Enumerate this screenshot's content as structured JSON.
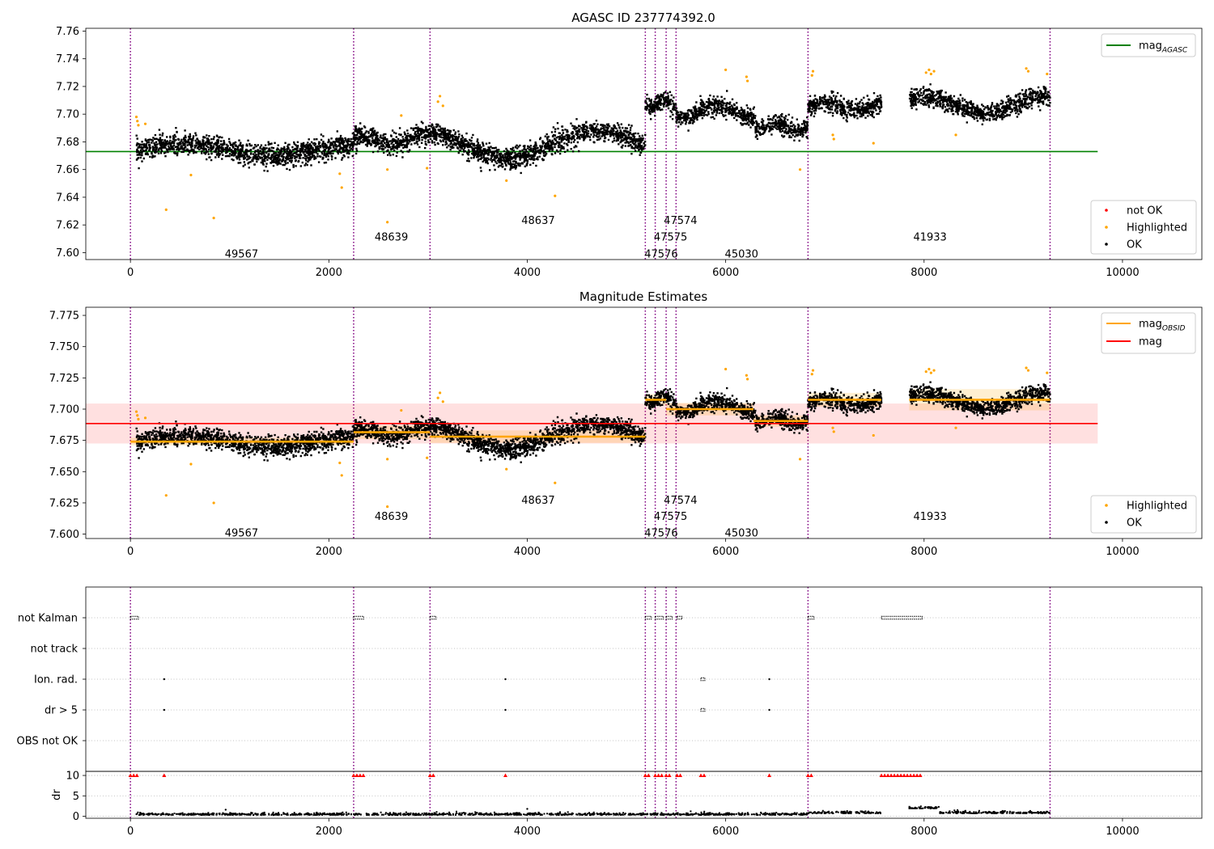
{
  "colors": {
    "ok": "#000000",
    "highlighted": "#ffa500",
    "not_ok": "#ff0000",
    "mag_agasc": "#008000",
    "mag_obsid": "#ffa500",
    "mag": "#ff0000",
    "obs_boundary": "#800080",
    "grid": "#b0b0b0"
  },
  "chart_data": [
    {
      "type": "scatter",
      "title": "AGASC ID 237774392.0",
      "xlim": [
        -450,
        10800
      ],
      "ylim": [
        7.595,
        7.762
      ],
      "xticks": [
        0,
        2000,
        4000,
        6000,
        8000,
        10000
      ],
      "yticks": [
        7.6,
        7.62,
        7.64,
        7.66,
        7.68,
        7.7,
        7.72,
        7.74,
        7.76
      ],
      "ytick_labels": [
        "7.60",
        "7.62",
        "7.64",
        "7.66",
        "7.68",
        "7.70",
        "7.72",
        "7.74",
        "7.76"
      ],
      "lines": [
        {
          "name": "mag",
          "sub": "AGASC",
          "y": 7.673,
          "x": [
            -450,
            9750
          ]
        }
      ],
      "legend_upper": [
        {
          "label": "mag",
          "sub": "AGASC",
          "color": "#008000"
        }
      ],
      "legend_lower": [
        {
          "label": "not OK",
          "color": "#ff0000"
        },
        {
          "label": "Highlighted",
          "color": "#ffa500"
        },
        {
          "label": "OK",
          "color": "#000000"
        }
      ],
      "obsid_labels": [
        {
          "text": "49567",
          "x": 1120,
          "y": 7.5995
        },
        {
          "text": "48639",
          "x": 2630,
          "y": 7.6115
        },
        {
          "text": "48637",
          "x": 4110,
          "y": 7.6235
        },
        {
          "text": "47574",
          "x": 5545,
          "y": 7.6235
        },
        {
          "text": "47575",
          "x": 5445,
          "y": 7.6115
        },
        {
          "text": "47576",
          "x": 5350,
          "y": 7.5995
        },
        {
          "text": "45030",
          "x": 6160,
          "y": 7.5995
        },
        {
          "text": "41933",
          "x": 8060,
          "y": 7.6115
        }
      ]
    },
    {
      "type": "scatter",
      "title": "Magnitude Estimates",
      "xlim": [
        -450,
        10800
      ],
      "ylim": [
        7.5965,
        7.7815
      ],
      "xticks": [
        0,
        2000,
        4000,
        6000,
        8000,
        10000
      ],
      "yticks": [
        7.6,
        7.625,
        7.65,
        7.675,
        7.7,
        7.725,
        7.75,
        7.775
      ],
      "ytick_labels": [
        "7.600",
        "7.625",
        "7.650",
        "7.675",
        "7.700",
        "7.725",
        "7.750",
        "7.775"
      ],
      "mag_band": {
        "center": 7.6885,
        "low": 7.6725,
        "high": 7.7045,
        "x": [
          -450,
          9750
        ]
      },
      "obsid_mags": [
        {
          "x0": 0,
          "x1": 2250,
          "y": 7.674,
          "low": 7.671,
          "high": 7.677
        },
        {
          "x0": 2250,
          "x1": 3020,
          "y": 7.6815,
          "low": 7.676,
          "high": 7.687
        },
        {
          "x0": 3020,
          "x1": 5190,
          "y": 7.678,
          "low": 7.673,
          "high": 7.683
        },
        {
          "x0": 5190,
          "x1": 5400,
          "y": 7.7075,
          "low": 7.703,
          "high": 7.712
        },
        {
          "x0": 5400,
          "x1": 6280,
          "y": 7.7,
          "low": 7.695,
          "high": 7.705
        },
        {
          "x0": 6280,
          "x1": 6830,
          "y": 7.6905,
          "low": 7.686,
          "high": 7.695
        },
        {
          "x0": 6830,
          "x1": 7570,
          "y": 7.7075,
          "low": 7.702,
          "high": 7.713
        },
        {
          "x0": 7850,
          "x1": 9270,
          "y": 7.7075,
          "low": 7.699,
          "high": 7.716
        }
      ],
      "legend_upper": [
        {
          "label": "mag",
          "sub": "OBSID",
          "color": "#ffa500"
        },
        {
          "label": "mag",
          "sub": "",
          "color": "#ff0000"
        }
      ],
      "legend_lower": [
        {
          "label": "Highlighted",
          "color": "#ffa500"
        },
        {
          "label": "OK",
          "color": "#000000"
        }
      ],
      "obsid_labels": [
        {
          "text": "49567",
          "x": 1120,
          "y": 7.6015
        },
        {
          "text": "48639",
          "x": 2630,
          "y": 7.6145
        },
        {
          "text": "48637",
          "x": 4110,
          "y": 7.6275
        },
        {
          "text": "47574",
          "x": 5545,
          "y": 7.6275
        },
        {
          "text": "47575",
          "x": 5445,
          "y": 7.6145
        },
        {
          "text": "47576",
          "x": 5350,
          "y": 7.6015
        },
        {
          "text": "45030",
          "x": 6160,
          "y": 7.6015
        },
        {
          "text": "41933",
          "x": 8060,
          "y": 7.6145
        }
      ]
    },
    {
      "type": "scatter",
      "title": "",
      "xlim": [
        -450,
        10800
      ],
      "categories": [
        "not Kalman",
        "not track",
        "Ion. rad.",
        "dr > 5",
        "OBS not OK"
      ],
      "flags": {
        "not Kalman": [
          [
            0,
            80
          ],
          [
            2250,
            2350
          ],
          [
            3020,
            3080
          ],
          [
            5190,
            5250
          ],
          [
            5290,
            5370
          ],
          [
            5400,
            5460
          ],
          [
            5510,
            5560
          ],
          [
            6830,
            6890
          ],
          [
            7570,
            7980
          ]
        ],
        "not track": [],
        "Ion. rad.": [
          [
            340,
            350
          ],
          [
            3780,
            3790
          ],
          [
            5750,
            5790
          ],
          [
            6440,
            6450
          ]
        ],
        "dr > 5": [
          [
            340,
            350
          ],
          [
            3780,
            3790
          ],
          [
            5750,
            5790
          ],
          [
            6440,
            6450
          ]
        ],
        "OBS not OK": []
      }
    },
    {
      "type": "scatter",
      "title": "",
      "ylabel": "dr",
      "xlim": [
        -450,
        10800
      ],
      "ylim": [
        -0.5,
        11
      ],
      "yticks": [
        0,
        5,
        10
      ],
      "xticks": [
        0,
        2000,
        4000,
        6000,
        8000,
        10000
      ],
      "clipped_value": 10,
      "clipped_ranges": [
        [
          0,
          80
        ],
        [
          2250,
          2350
        ],
        [
          3020,
          3080
        ],
        [
          5190,
          5250
        ],
        [
          5290,
          5370
        ],
        [
          5400,
          5460
        ],
        [
          5510,
          5560
        ],
        [
          5750,
          5790
        ],
        [
          6830,
          6890
        ],
        [
          7570,
          7980
        ]
      ],
      "clipped_points": [
        340,
        3780,
        6440
      ]
    }
  ],
  "obs_boundaries": [
    0,
    2250,
    3020,
    5190,
    5290,
    5400,
    5500,
    6830,
    9270
  ],
  "segments": [
    {
      "x0": 60,
      "x1": 2250,
      "base": 7.674,
      "wave": 0.004,
      "noise": 0.007
    },
    {
      "x0": 2250,
      "x1": 3020,
      "base": 7.6815,
      "wave": 0.003,
      "noise": 0.007
    },
    {
      "x0": 3020,
      "x1": 5190,
      "base": 7.678,
      "wave": 0.01,
      "noise": 0.007
    },
    {
      "x0": 5190,
      "x1": 5500,
      "base": 7.7075,
      "wave": 0.003,
      "noise": 0.006
    },
    {
      "x0": 5500,
      "x1": 6300,
      "base": 7.702,
      "wave": 0.004,
      "noise": 0.006
    },
    {
      "x0": 6300,
      "x1": 6830,
      "base": 7.6905,
      "wave": 0.002,
      "noise": 0.006
    },
    {
      "x0": 6830,
      "x1": 7570,
      "base": 7.7055,
      "wave": 0.003,
      "noise": 0.006
    },
    {
      "x0": 7850,
      "x1": 9270,
      "base": 7.7065,
      "wave": 0.006,
      "noise": 0.006
    }
  ],
  "highlighted_points": [
    {
      "x": 60,
      "y": 7.698
    },
    {
      "x": 70,
      "y": 7.695
    },
    {
      "x": 80,
      "y": 7.692
    },
    {
      "x": 150,
      "y": 7.693
    },
    {
      "x": 360,
      "y": 7.631
    },
    {
      "x": 610,
      "y": 7.656
    },
    {
      "x": 840,
      "y": 7.625
    },
    {
      "x": 2110,
      "y": 7.657
    },
    {
      "x": 2130,
      "y": 7.647
    },
    {
      "x": 2590,
      "y": 7.622
    },
    {
      "x": 2590,
      "y": 7.66
    },
    {
      "x": 2730,
      "y": 7.699
    },
    {
      "x": 2990,
      "y": 7.661
    },
    {
      "x": 3100,
      "y": 7.709
    },
    {
      "x": 3120,
      "y": 7.713
    },
    {
      "x": 3150,
      "y": 7.706
    },
    {
      "x": 3790,
      "y": 7.652
    },
    {
      "x": 4280,
      "y": 7.641
    },
    {
      "x": 6000,
      "y": 7.732
    },
    {
      "x": 6210,
      "y": 7.727
    },
    {
      "x": 6220,
      "y": 7.724
    },
    {
      "x": 6750,
      "y": 7.66
    },
    {
      "x": 6880,
      "y": 7.731
    },
    {
      "x": 6870,
      "y": 7.728
    },
    {
      "x": 7080,
      "y": 7.685
    },
    {
      "x": 7090,
      "y": 7.682
    },
    {
      "x": 7490,
      "y": 7.679
    },
    {
      "x": 8020,
      "y": 7.73
    },
    {
      "x": 8050,
      "y": 7.732
    },
    {
      "x": 8070,
      "y": 7.729
    },
    {
      "x": 8100,
      "y": 7.731
    },
    {
      "x": 8320,
      "y": 7.685
    },
    {
      "x": 9030,
      "y": 7.733
    },
    {
      "x": 9050,
      "y": 7.731
    },
    {
      "x": 9240,
      "y": 7.729
    }
  ]
}
